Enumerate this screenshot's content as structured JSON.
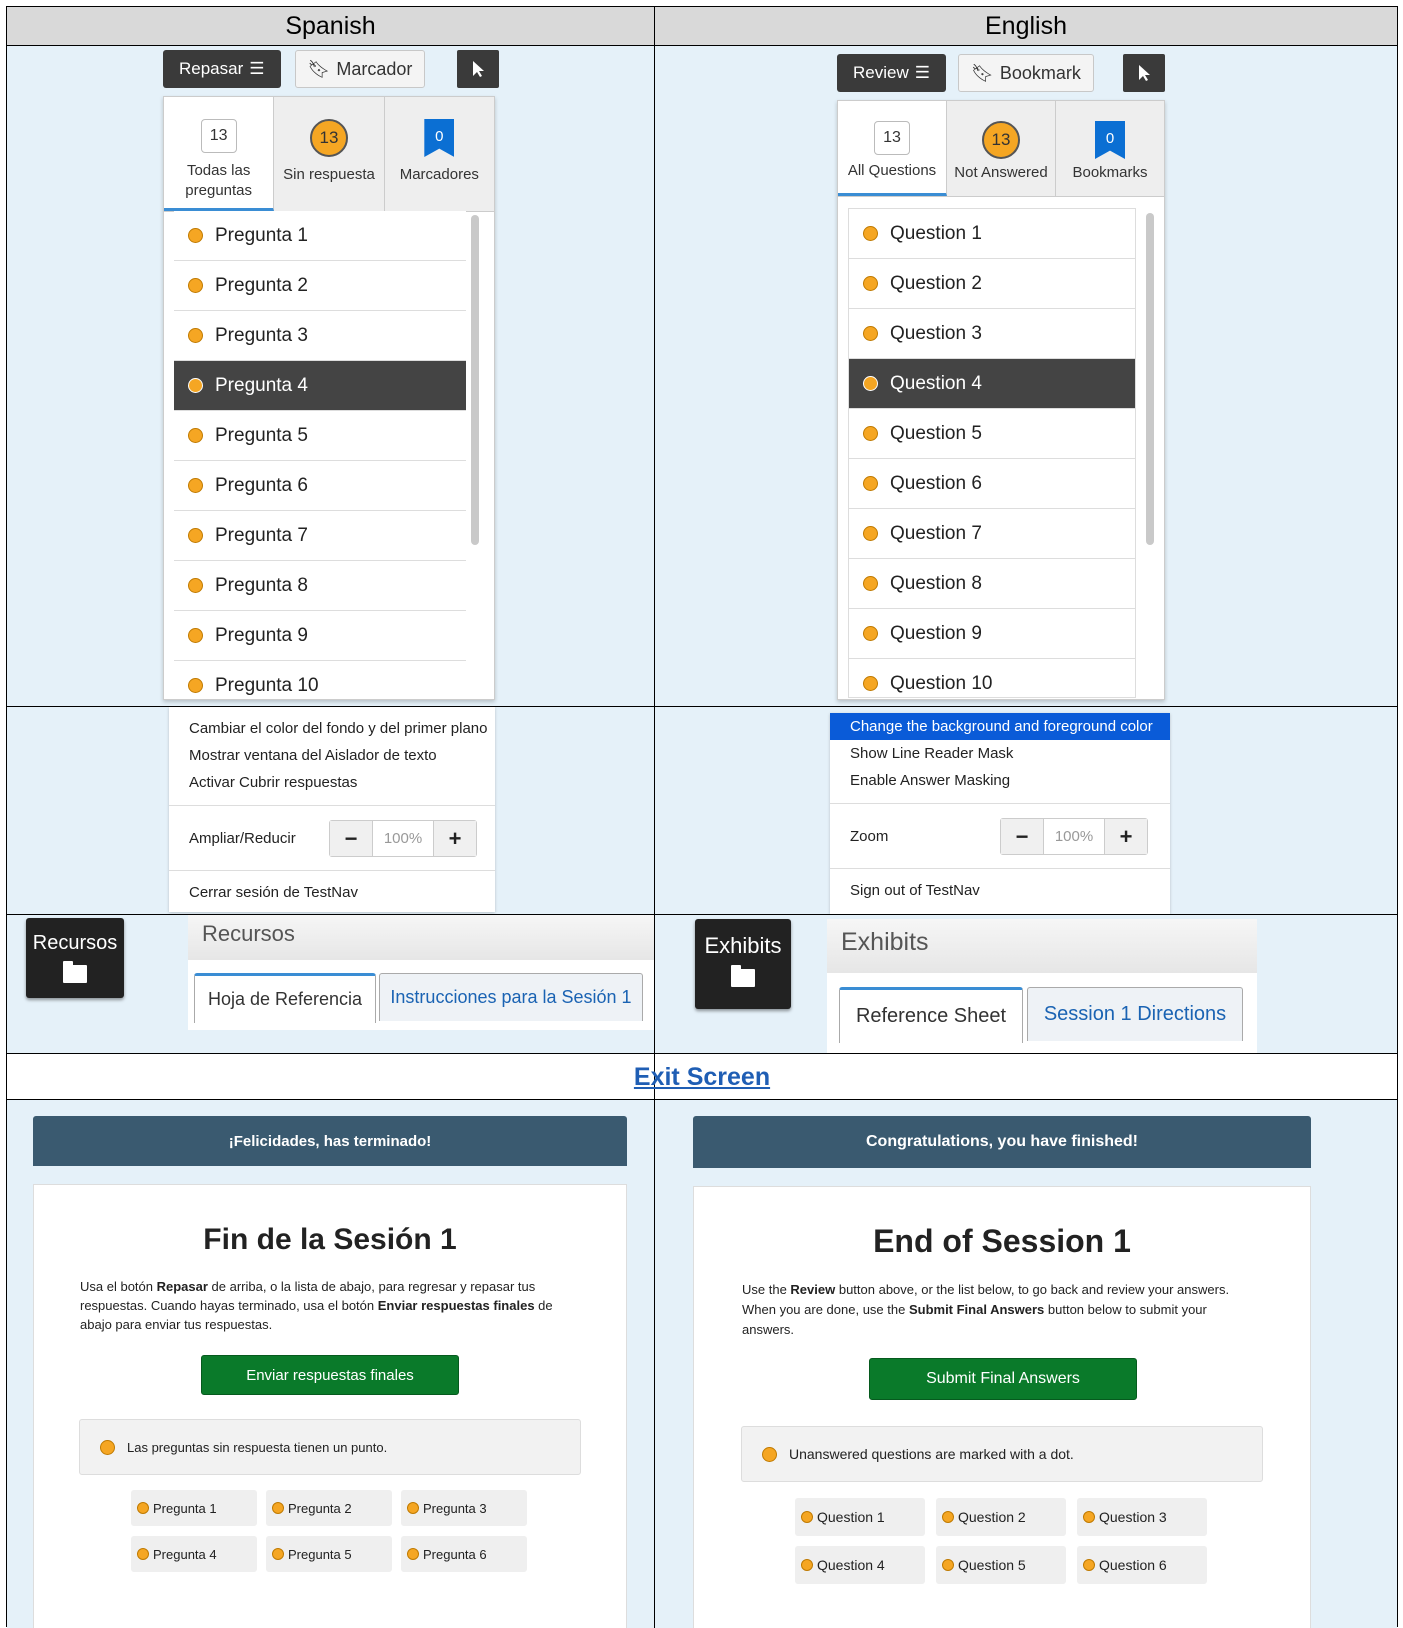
{
  "headers": {
    "spanish": "Spanish",
    "english": "English"
  },
  "es": {
    "review_label": "Repasar",
    "bookmark_label": "Marcador",
    "tabs": [
      {
        "count": "13",
        "label": "Todas las preguntas"
      },
      {
        "count": "13",
        "label": "Sin respuesta"
      },
      {
        "count": "0",
        "label": "Marcadores"
      }
    ],
    "questions": [
      "Pregunta 1",
      "Pregunta 2",
      "Pregunta 3",
      "Pregunta 4",
      "Pregunta 5",
      "Pregunta 6",
      "Pregunta 7",
      "Pregunta 8",
      "Pregunta 9",
      "Pregunta 10"
    ],
    "menu": [
      "Cambiar el color del fondo y del primer plano",
      "Mostrar ventana del Aislador de texto",
      "Activar Cubrir respuestas"
    ],
    "zoom_label": "Ampliar/Reducir",
    "zoom_value": "100%",
    "signout": "Cerrar sesión de TestNav",
    "exhibits_button": "Recursos",
    "exhibits_title": "Recursos",
    "exhibit_tabs": [
      "Hoja de Referencia",
      "Instrucciones para la Sesión 1"
    ],
    "congrats": "¡Felicidades, has terminado!",
    "end_title": "Fin de la Sesión 1",
    "instr": {
      "p1": "Usa el botón ",
      "b1": "Repasar",
      "p2": " de arriba, o la lista de abajo, para regresar y repasar tus respuestas. Cuando hayas terminado, usa el botón ",
      "b2": "Enviar respuestas finales",
      "p3": " de abajo para enviar tus respuestas."
    },
    "submit": "Enviar respuestas finales",
    "legend": "Las preguntas sin respuesta tienen un punto.",
    "chips": [
      "Pregunta 1",
      "Pregunta 2",
      "Pregunta 3",
      "Pregunta 4",
      "Pregunta 5",
      "Pregunta 6"
    ]
  },
  "en": {
    "review_label": "Review",
    "bookmark_label": "Bookmark",
    "tabs": [
      {
        "count": "13",
        "label": "All Questions"
      },
      {
        "count": "13",
        "label": "Not Answered"
      },
      {
        "count": "0",
        "label": "Bookmarks"
      }
    ],
    "questions": [
      "Question 1",
      "Question 2",
      "Question 3",
      "Question 4",
      "Question 5",
      "Question 6",
      "Question 7",
      "Question 8",
      "Question 9",
      "Question 10"
    ],
    "menu": [
      "Change the background and foreground color",
      "Show Line Reader Mask",
      "Enable Answer Masking"
    ],
    "zoom_label": "Zoom",
    "zoom_value": "100%",
    "signout": "Sign out of TestNav",
    "exhibits_button": "Exhibits",
    "exhibits_title": "Exhibits",
    "exhibit_tabs": [
      "Reference Sheet",
      "Session 1 Directions"
    ],
    "congrats": "Congratulations, you have finished!",
    "end_title": "End of Session 1",
    "instr": {
      "p1": "Use the ",
      "b1": "Review",
      "p2": " button above, or the list below, to go back and review your answers. When you are done, use the ",
      "b2": "Submit Final Answers",
      "p3": " button below to submit your answers."
    },
    "submit": "Submit Final Answers",
    "legend": "Unanswered questions are marked with a dot.",
    "chips": [
      "Question 1",
      "Question 2",
      "Question 3",
      "Question 4",
      "Question 5",
      "Question 6"
    ]
  },
  "exit_screen_title": "Exit Screen",
  "colors": {
    "accent_orange": "#f5a623",
    "bookmark_blue": "#0b6fd3",
    "submit_green": "#0a7a2a",
    "header_slate": "#3a5a70",
    "menu_highlight": "#0a5bd8"
  }
}
